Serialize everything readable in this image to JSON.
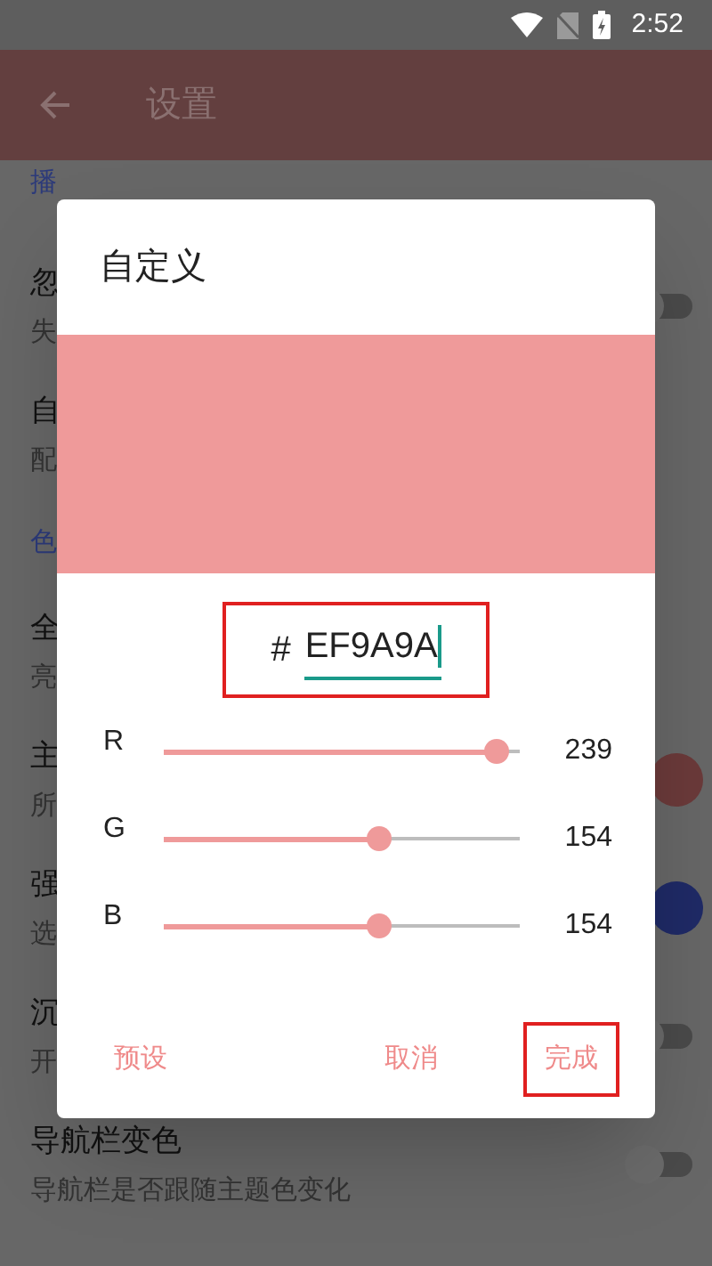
{
  "status_bar": {
    "time": "2:52"
  },
  "app_bar": {
    "title": "设置"
  },
  "settings": [
    {
      "kind": "header",
      "title": "播"
    },
    {
      "kind": "switch_row",
      "title": "忽",
      "subtitle": "失",
      "on": false
    },
    {
      "kind": "row",
      "title": "自",
      "subtitle": "配"
    },
    {
      "kind": "header",
      "title": "色"
    },
    {
      "kind": "row",
      "title": "全",
      "subtitle": "亮"
    },
    {
      "kind": "color_row",
      "title": "主",
      "subtitle": "所",
      "color": "#6b3a3a"
    },
    {
      "kind": "color_row",
      "title": "强",
      "subtitle": "选",
      "color": "#1f2a66"
    },
    {
      "kind": "switch_row",
      "title": "沉",
      "subtitle": "开",
      "on": false
    },
    {
      "kind": "switch_row",
      "title": "导航栏变色",
      "subtitle": "导航栏是否跟随主题色变化",
      "on": false
    }
  ],
  "dialog": {
    "title": "自定义",
    "color": "#ef9a9a",
    "hash": "#",
    "hex": "EF9A9A",
    "channels": [
      {
        "label": "R",
        "level": 0.937,
        "reading": "239"
      },
      {
        "label": "G",
        "level": 0.604,
        "reading": "154"
      },
      {
        "label": "B",
        "level": 0.604,
        "reading": "154"
      }
    ],
    "buttons": [
      {
        "label": "预设",
        "highlighted": false
      },
      {
        "label": "取消",
        "highlighted": false
      },
      {
        "label": "完成",
        "highlighted": true
      }
    ]
  }
}
